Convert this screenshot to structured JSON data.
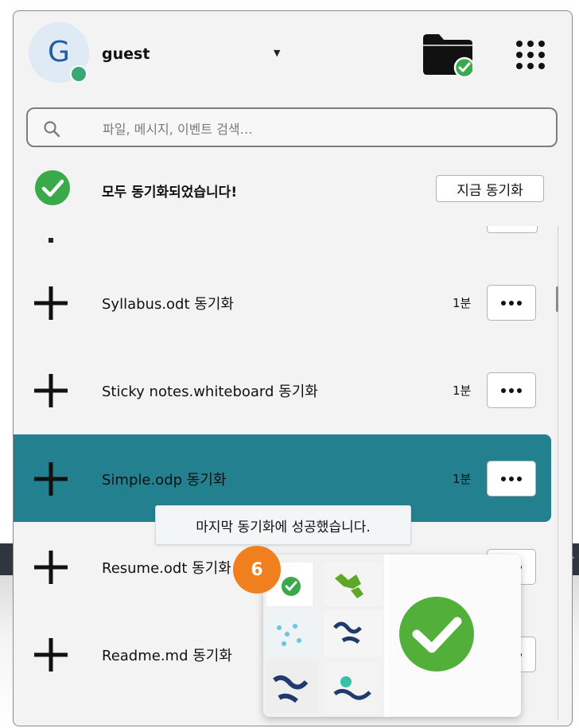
{
  "user": {
    "avatar_letter": "G",
    "name": "guest"
  },
  "search": {
    "placeholder": "파일, 메시지, 이벤트 검색…"
  },
  "status": {
    "text": "모두 동기화되었습니다!",
    "sync_now_label": "지금 동기화"
  },
  "activities": [
    {
      "name": "Syllabus.odt 동기화",
      "time": "1분",
      "active": false
    },
    {
      "name": "Sticky notes.whiteboard 동기화",
      "time": "1분",
      "active": false
    },
    {
      "name": "Simple.odp 동기화",
      "time": "1분",
      "active": true
    },
    {
      "name": "Resume.odt 동기화",
      "time": "",
      "active": false
    },
    {
      "name": "Readme.md 동기화",
      "time": "",
      "active": false
    }
  ],
  "tooltip": {
    "text": "마지막 동기화에 성공했습니다."
  },
  "step_badge": {
    "number": "6"
  },
  "colors": {
    "accent_active_row": "#22808f",
    "success_green": "#3aa94a",
    "step_badge_orange": "#f0801d",
    "avatar_status": "#3aa778"
  },
  "icons": {
    "user_menu": "chevron-down-icon",
    "folder": "folder-synced-icon",
    "apps": "app-grid-icon",
    "search": "search-icon",
    "status": "check-circle-icon",
    "activity": "plus-icon",
    "more": "more-horizontal-icon"
  }
}
